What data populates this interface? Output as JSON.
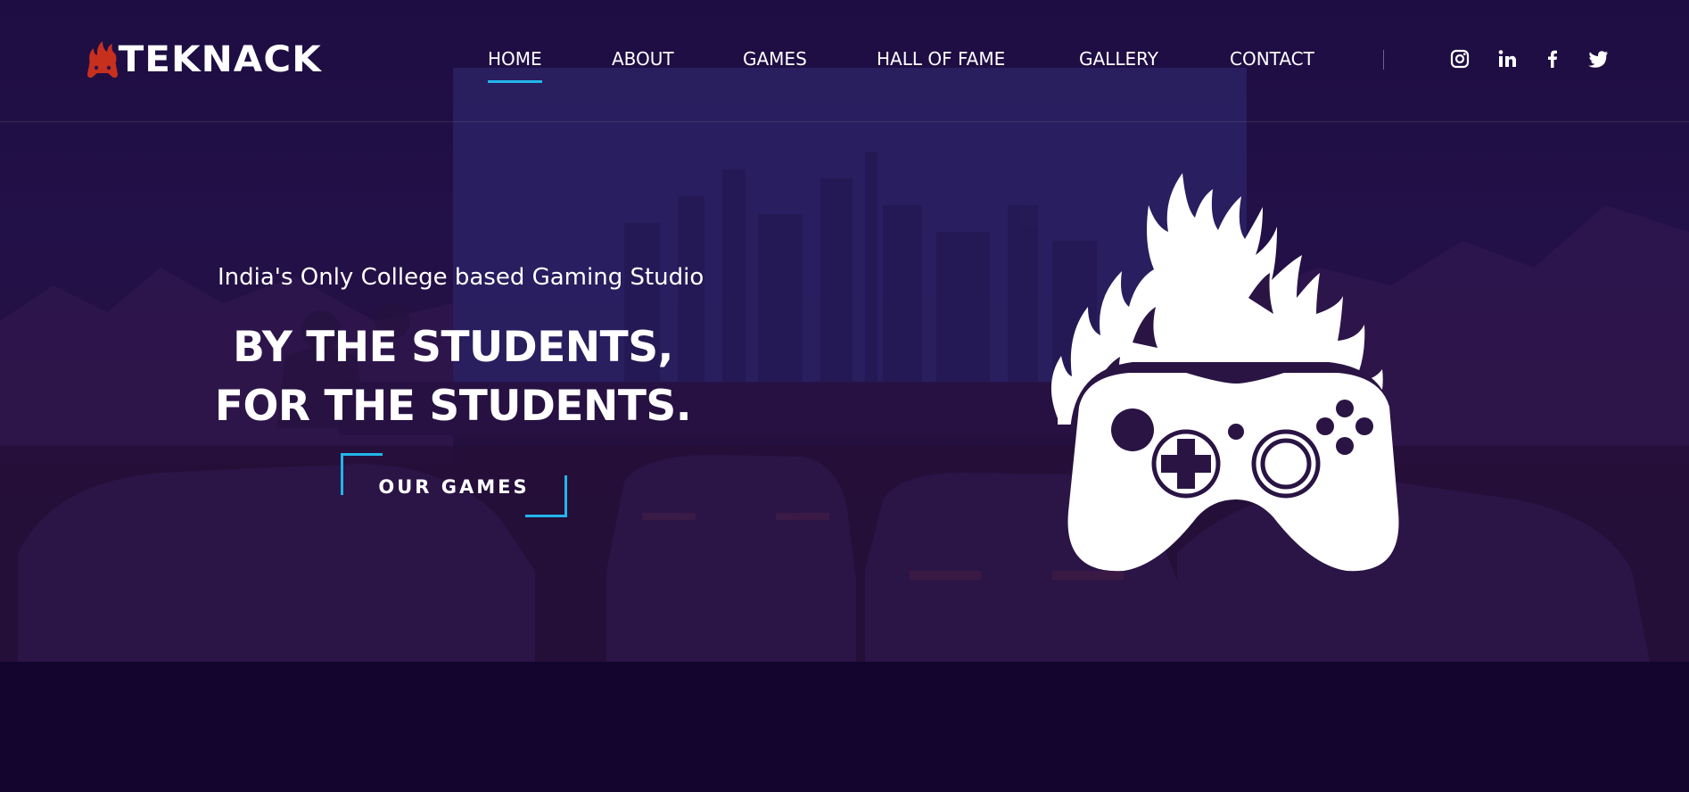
{
  "brand": {
    "logo_text": "TEKNACK",
    "flame_color": "#c8301e",
    "accent": "#22b5ea"
  },
  "nav": {
    "items": [
      {
        "label": "HOME",
        "active": true
      },
      {
        "label": "ABOUT",
        "active": false
      },
      {
        "label": "GAMES",
        "active": false
      },
      {
        "label": "HALL OF FAME",
        "active": false
      },
      {
        "label": "GALLERY",
        "active": false
      },
      {
        "label": "CONTACT",
        "active": false
      }
    ],
    "social": [
      "instagram-icon",
      "linkedin-icon",
      "facebook-icon",
      "twitter-icon"
    ]
  },
  "hero": {
    "tagline": "India's Only College based Gaming Studio",
    "headline_line1": "BY THE STUDENTS,",
    "headline_line2": "FOR THE STUDENTS.",
    "cta_label": "OUR GAMES",
    "emblem": "flaming-gamepad-icon"
  }
}
